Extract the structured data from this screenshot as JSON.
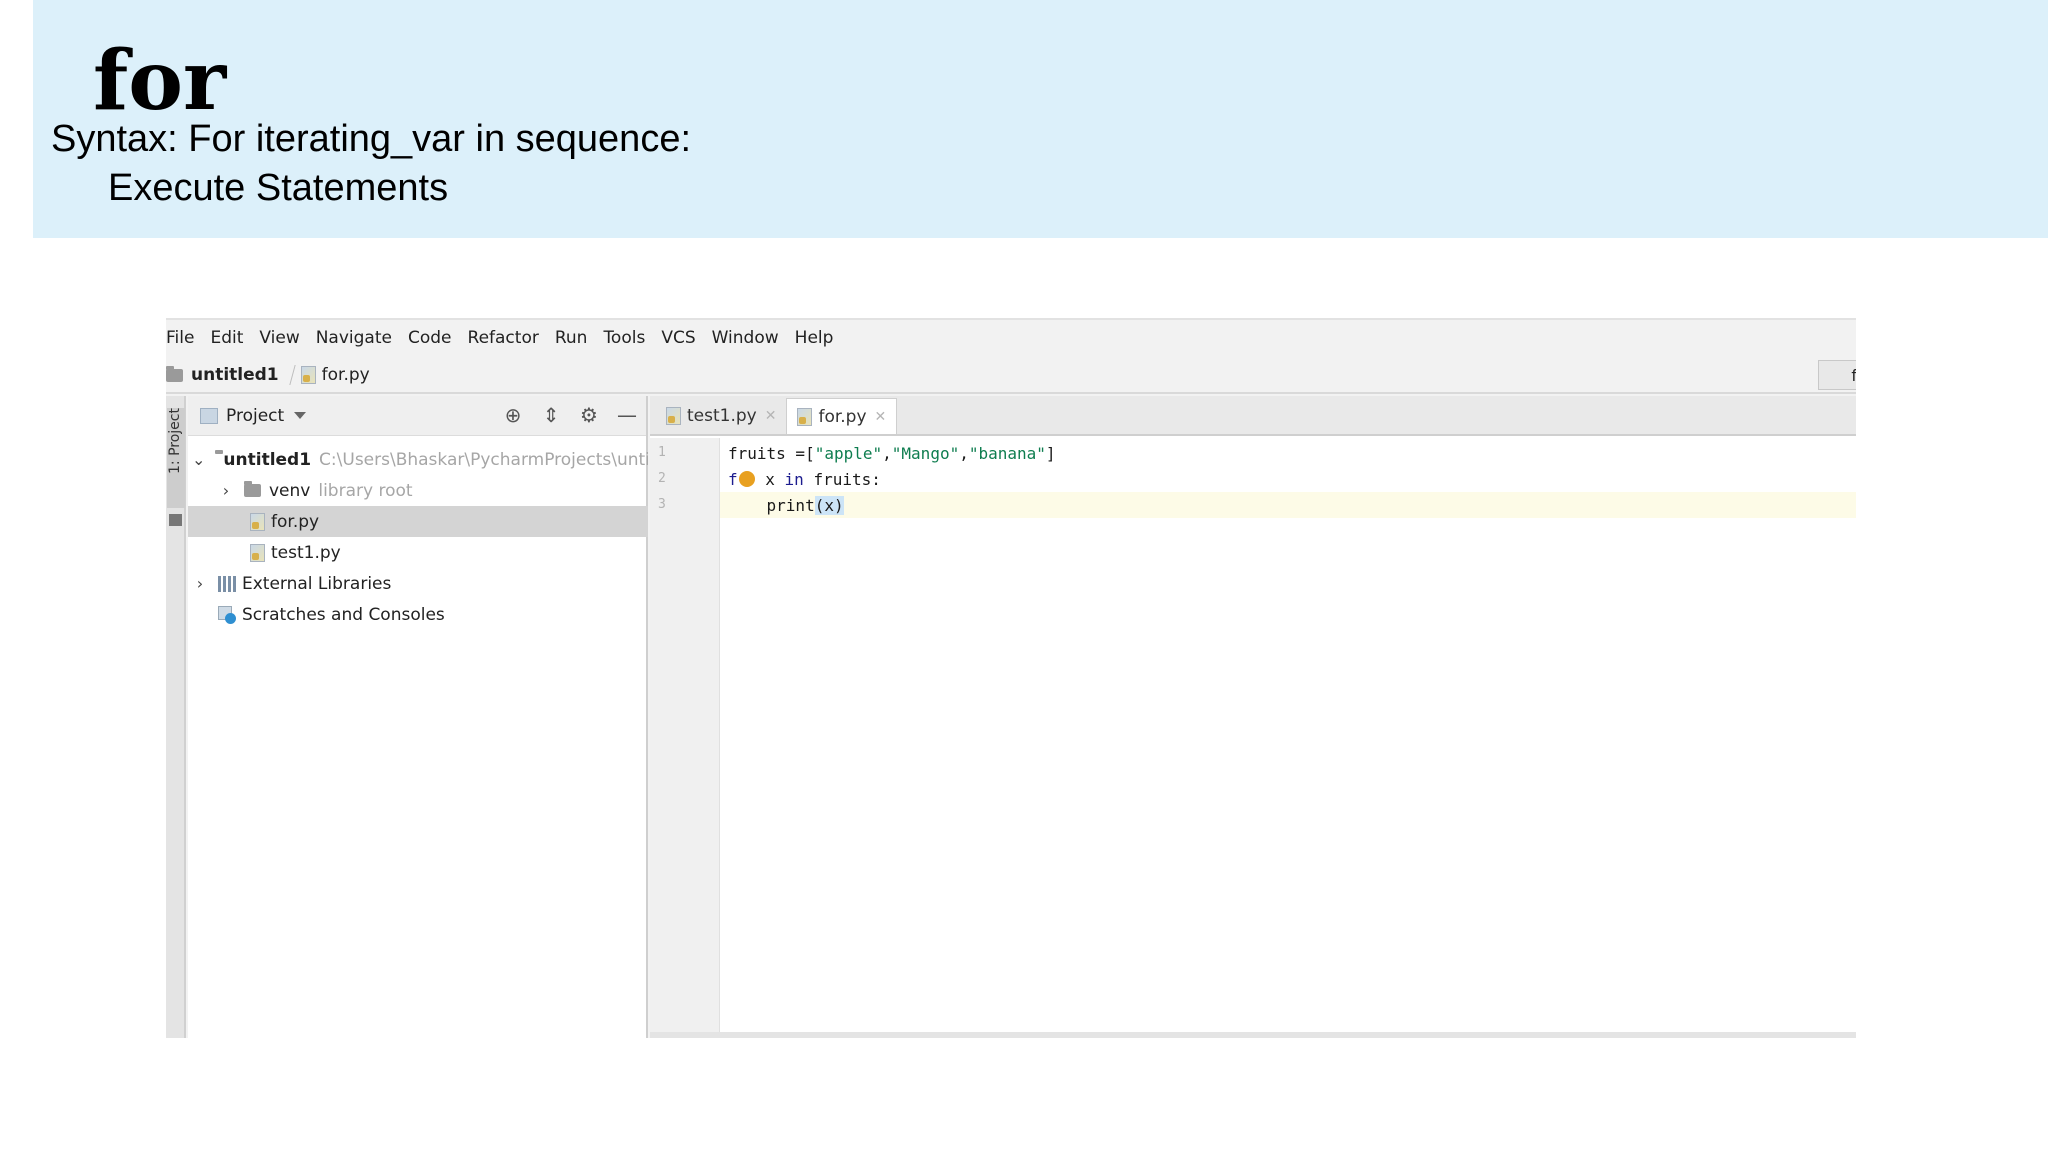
{
  "slide": {
    "title": "for",
    "syntax_line1": "Syntax: For iterating_var in sequence:",
    "syntax_line2": "Execute Statements"
  },
  "ide": {
    "menu": [
      "File",
      "Edit",
      "View",
      "Navigate",
      "Code",
      "Refactor",
      "Run",
      "Tools",
      "VCS",
      "Window",
      "Help"
    ],
    "breadcrumb": {
      "project": "untitled1",
      "file": "for.py"
    },
    "nav_right_label": "f",
    "side_strip_label": "1: Project",
    "project_panel": {
      "title": "Project",
      "tree": {
        "root_name": "untitled1",
        "root_path": "C:\\Users\\Bhaskar\\PycharmProjects\\untitled",
        "venv_name": "venv",
        "venv_note": "library root",
        "file1": "for.py",
        "file2": "test1.py",
        "external": "External Libraries",
        "scratches": "Scratches and Consoles"
      }
    },
    "tabs": [
      {
        "label": "test1.py",
        "active": false
      },
      {
        "label": "for.py",
        "active": true
      }
    ],
    "line_numbers": [
      "1",
      "2",
      "3"
    ],
    "code": {
      "l1_var": "fruits =[",
      "l1_s1": "\"apple\"",
      "l1_c1": ",",
      "l1_s2": "\"Mango\"",
      "l1_c2": ",",
      "l1_s3": "\"banana\"",
      "l1_end": "]",
      "l2_kw1": "f",
      "l2_mid": " x ",
      "l2_kw2": "in",
      "l2_end": " fruits:",
      "l3_pre": "    print",
      "l3_args": "(x)"
    },
    "colors": {
      "header_band": "#dcf0fa",
      "string": "#0e7d4f",
      "keyword": "#1d1d8f",
      "current_line": "#fdfbe7"
    }
  }
}
